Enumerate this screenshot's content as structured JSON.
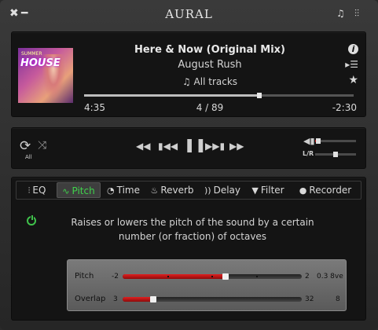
{
  "app": {
    "title": "AURAL"
  },
  "titlebar": {
    "close_icon": "close-icon",
    "minimize_icon": "minimize-icon",
    "playlist_icon": "playlist-icon",
    "equalizer_icon": "equalizer-icon"
  },
  "now_playing": {
    "album_art_text": "HOUSE",
    "album_art_subtext": "SUMMER",
    "title": "Here & Now (Original Mix)",
    "artist": "August Rush",
    "playlist": "All tracks",
    "elapsed": "4:35",
    "position": "4 / 89",
    "remaining": "-2:30",
    "progress": 0.65
  },
  "transport": {
    "repeat_label": "All",
    "volume_level": 0.08,
    "balance_label": "L/R",
    "balance_level": 0.5
  },
  "effects": {
    "tabs": [
      {
        "label": "EQ",
        "icon": "equalizer-icon"
      },
      {
        "label": "Pitch",
        "icon": "pitch-wave-icon"
      },
      {
        "label": "Time",
        "icon": "tempo-dial-icon"
      },
      {
        "label": "Reverb",
        "icon": "reverb-icon"
      },
      {
        "label": "Delay",
        "icon": "delay-icon"
      },
      {
        "label": "Filter",
        "icon": "filter-icon"
      },
      {
        "label": "Recorder",
        "icon": "microphone-icon"
      }
    ],
    "active_tab": "Pitch",
    "description": "Raises or lowers the pitch of the sound by a certain number (or fraction) of octaves",
    "pitch": {
      "label": "Pitch",
      "min": "-2",
      "max": "2",
      "value": "0.3 8ve",
      "level": 0.575
    },
    "overlap": {
      "label": "Overlap",
      "min": "3",
      "max": "32",
      "value": "8",
      "level": 0.17
    },
    "accent_color": "#3fd24b",
    "slider_color": "#c01818"
  }
}
